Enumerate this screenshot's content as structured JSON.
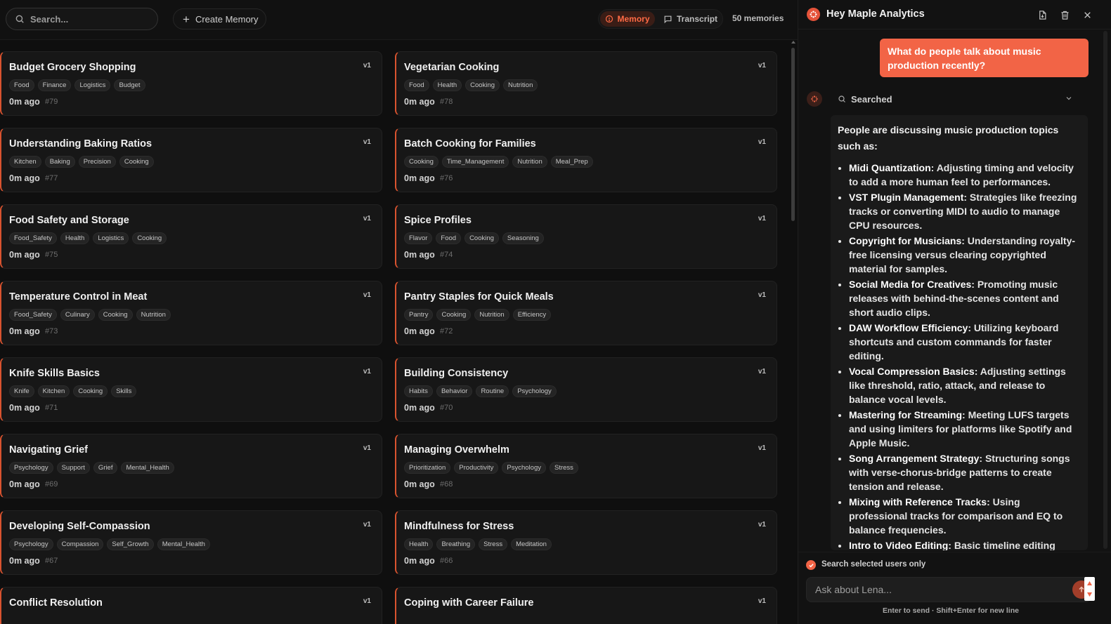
{
  "toolbar": {
    "search_placeholder": "Search...",
    "create_label": "Create Memory",
    "memory_tab": "Memory",
    "transcript_tab": "Transcript",
    "count_label": "50 memories"
  },
  "memories": [
    {
      "title": "Budget Grocery Shopping",
      "tags": [
        "Food",
        "Finance",
        "Logistics",
        "Budget"
      ],
      "time": "0m ago",
      "id": "#79",
      "version": "v1"
    },
    {
      "title": "Vegetarian Cooking",
      "tags": [
        "Food",
        "Health",
        "Cooking",
        "Nutrition"
      ],
      "time": "0m ago",
      "id": "#78",
      "version": "v1"
    },
    {
      "title": "Understanding Baking Ratios",
      "tags": [
        "Kitchen",
        "Baking",
        "Precision",
        "Cooking"
      ],
      "time": "0m ago",
      "id": "#77",
      "version": "v1"
    },
    {
      "title": "Batch Cooking for Families",
      "tags": [
        "Cooking",
        "Time_Management",
        "Nutrition",
        "Meal_Prep"
      ],
      "time": "0m ago",
      "id": "#76",
      "version": "v1"
    },
    {
      "title": "Food Safety and Storage",
      "tags": [
        "Food_Safety",
        "Health",
        "Logistics",
        "Cooking"
      ],
      "time": "0m ago",
      "id": "#75",
      "version": "v1"
    },
    {
      "title": "Spice Profiles",
      "tags": [
        "Flavor",
        "Food",
        "Cooking",
        "Seasoning"
      ],
      "time": "0m ago",
      "id": "#74",
      "version": "v1"
    },
    {
      "title": "Temperature Control in Meat",
      "tags": [
        "Food_Safety",
        "Culinary",
        "Cooking",
        "Nutrition"
      ],
      "time": "0m ago",
      "id": "#73",
      "version": "v1"
    },
    {
      "title": "Pantry Staples for Quick Meals",
      "tags": [
        "Pantry",
        "Cooking",
        "Nutrition",
        "Efficiency"
      ],
      "time": "0m ago",
      "id": "#72",
      "version": "v1"
    },
    {
      "title": "Knife Skills Basics",
      "tags": [
        "Knife",
        "Kitchen",
        "Cooking",
        "Skills"
      ],
      "time": "0m ago",
      "id": "#71",
      "version": "v1"
    },
    {
      "title": "Building Consistency",
      "tags": [
        "Habits",
        "Behavior",
        "Routine",
        "Psychology"
      ],
      "time": "0m ago",
      "id": "#70",
      "version": "v1"
    },
    {
      "title": "Navigating Grief",
      "tags": [
        "Psychology",
        "Support",
        "Grief",
        "Mental_Health"
      ],
      "time": "0m ago",
      "id": "#69",
      "version": "v1"
    },
    {
      "title": "Managing Overwhelm",
      "tags": [
        "Prioritization",
        "Productivity",
        "Psychology",
        "Stress"
      ],
      "time": "0m ago",
      "id": "#68",
      "version": "v1"
    },
    {
      "title": "Developing Self-Compassion",
      "tags": [
        "Psychology",
        "Compassion",
        "Self_Growth",
        "Mental_Health"
      ],
      "time": "0m ago",
      "id": "#67",
      "version": "v1"
    },
    {
      "title": "Mindfulness for Stress",
      "tags": [
        "Health",
        "Breathing",
        "Stress",
        "Meditation"
      ],
      "time": "0m ago",
      "id": "#66",
      "version": "v1"
    },
    {
      "title": "Conflict Resolution",
      "tags": [],
      "time": "",
      "id": "",
      "version": "v1"
    },
    {
      "title": "Coping with Career Failure",
      "tags": [],
      "time": "",
      "id": "",
      "version": "v1"
    }
  ],
  "chat": {
    "title": "Hey Maple Analytics",
    "user_message": "What do people talk about music production recently?",
    "searched_label": "Searched",
    "answer_intro": "People are discussing music production topics such as:",
    "answer_items": [
      {
        "term": "Midi Quantization",
        "text": ": Adjusting timing and velocity to add a more human feel to performances."
      },
      {
        "term": "VST Plugin Management",
        "text": ": Strategies like freezing tracks or converting MIDI to audio to manage CPU resources."
      },
      {
        "term": "Copyright for Musicians",
        "text": ": Understanding royalty-free licensing versus clearing copyrighted material for samples."
      },
      {
        "term": "Social Media for Creatives",
        "text": ": Promoting music releases with behind-the-scenes content and short audio clips."
      },
      {
        "term": "DAW Workflow Efficiency",
        "text": ": Utilizing keyboard shortcuts and custom commands for faster editing."
      },
      {
        "term": "Vocal Compression Basics",
        "text": ": Adjusting settings like threshold, ratio, attack, and release to balance vocal levels."
      },
      {
        "term": "Mastering for Streaming",
        "text": ": Meeting LUFS targets and using limiters for platforms like Spotify and Apple Music."
      },
      {
        "term": "Song Arrangement Strategy",
        "text": ": Structuring songs with verse-chorus-bridge patterns to create tension and release."
      },
      {
        "term": "Mixing with Reference Tracks",
        "text": ": Using professional tracks for comparison and EQ to balance frequencies."
      },
      {
        "term": "Intro to Video Editing",
        "text": ": Basic timeline editing"
      }
    ],
    "checkbox_label": "Search selected users only",
    "input_placeholder": "Ask about Lena...",
    "hint": "Enter to send · Shift+Enter for new line"
  },
  "colors": {
    "accent": "#f26446",
    "card_border_accent": "#d9532f",
    "background": "#0f0f0f",
    "card_background": "#171717"
  },
  "icons": {
    "search": "search-icon",
    "create": "plus-icon",
    "memory_tab": "info-circle-icon",
    "transcript_tab": "message-square-icon",
    "export": "file-download-icon",
    "delete": "trash-icon",
    "close": "close-icon",
    "chevron": "chevron-down-icon",
    "send": "arrow-up-icon"
  }
}
